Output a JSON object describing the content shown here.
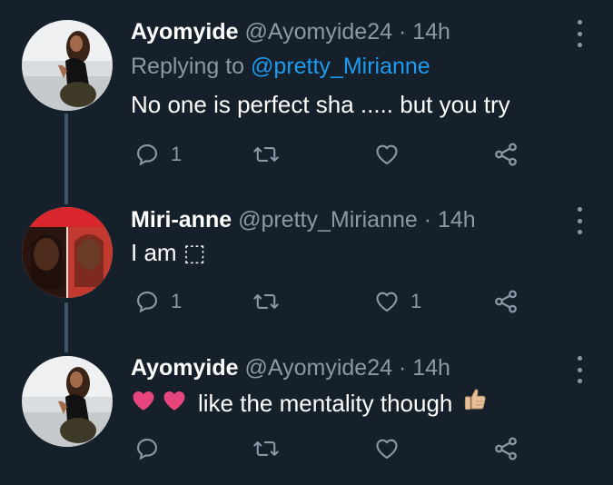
{
  "tweets": [
    {
      "name": "Ayomyide",
      "handle": "@Ayomyide24",
      "time": "· 14h",
      "replying_prefix": "Replying to ",
      "replying_handle": "@pretty_Mirianne",
      "text": "No one is perfect sha ..... but you try",
      "reply_count": "1",
      "retweet_count": "",
      "like_count": ""
    },
    {
      "name": "Miri-anne",
      "handle": "@pretty_Mirianne",
      "time": "· 14h",
      "text": "I am ⬚",
      "reply_count": "1",
      "retweet_count": "",
      "like_count": "1"
    },
    {
      "name": "Ayomyide",
      "handle": "@Ayomyide24",
      "time": "· 14h",
      "text": "like the mentality though",
      "reply_count": "",
      "retweet_count": "",
      "like_count": ""
    }
  ],
  "colors": {
    "background": "#15202b",
    "secondary_text": "#8b98a5",
    "link": "#1d9bf0",
    "thread_line": "#3d5466",
    "heart_emoji": "#e8457f"
  },
  "icons": [
    "reply-icon",
    "retweet-icon",
    "like-icon",
    "share-icon",
    "more-icon",
    "heart-emoji-icon",
    "thumbs-up-emoji-icon"
  ]
}
